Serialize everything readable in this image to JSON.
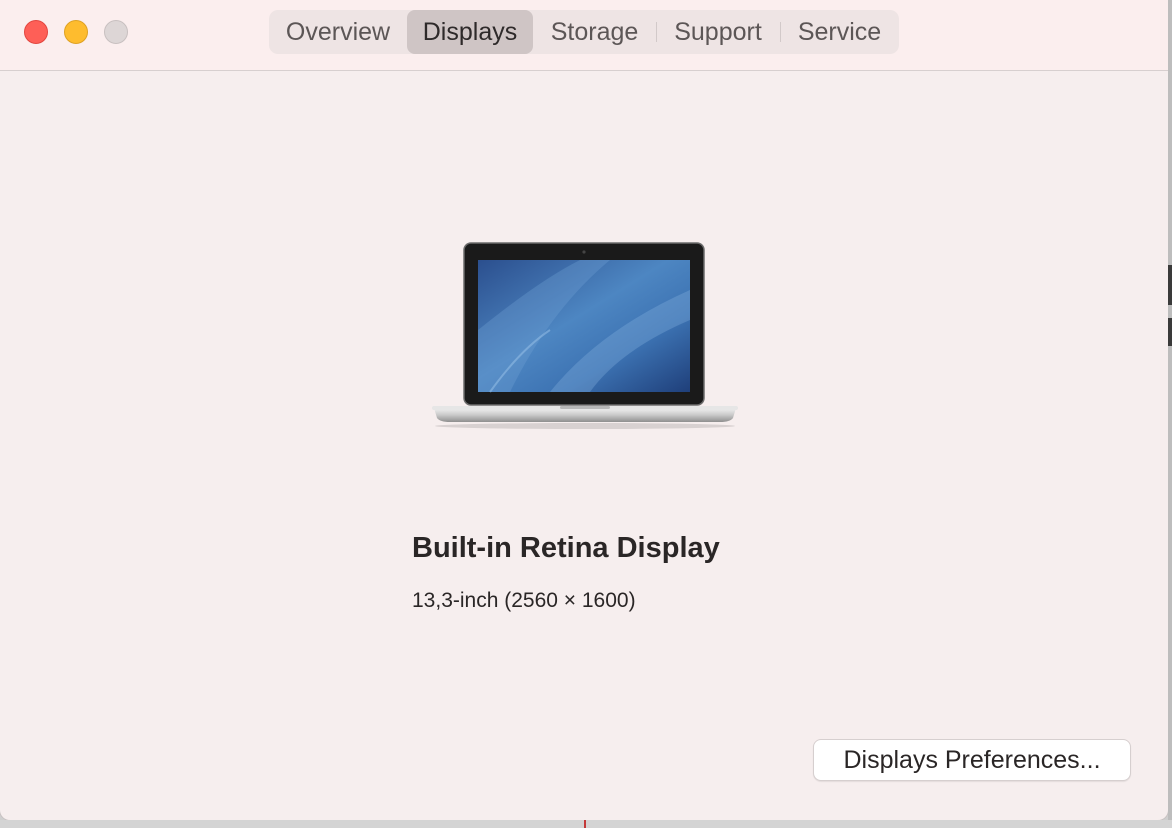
{
  "window": {
    "controls": [
      "close-icon",
      "minimize-icon",
      "zoom-icon"
    ]
  },
  "tabs": [
    {
      "label": "Overview",
      "active": false
    },
    {
      "label": "Displays",
      "active": true
    },
    {
      "label": "Storage",
      "active": false
    },
    {
      "label": "Support",
      "active": false
    },
    {
      "label": "Service",
      "active": false
    }
  ],
  "display": {
    "icon": "laptop-icon",
    "name": "Built-in Retina Display",
    "spec": "13,3-inch (2560 × 1600)"
  },
  "actions": {
    "preferences_label": "Displays Preferences..."
  },
  "colors": {
    "close": "#fe5f57",
    "minimize": "#febc2e",
    "zoom": "#ddd6d6",
    "screen": "#3d6fb0"
  }
}
